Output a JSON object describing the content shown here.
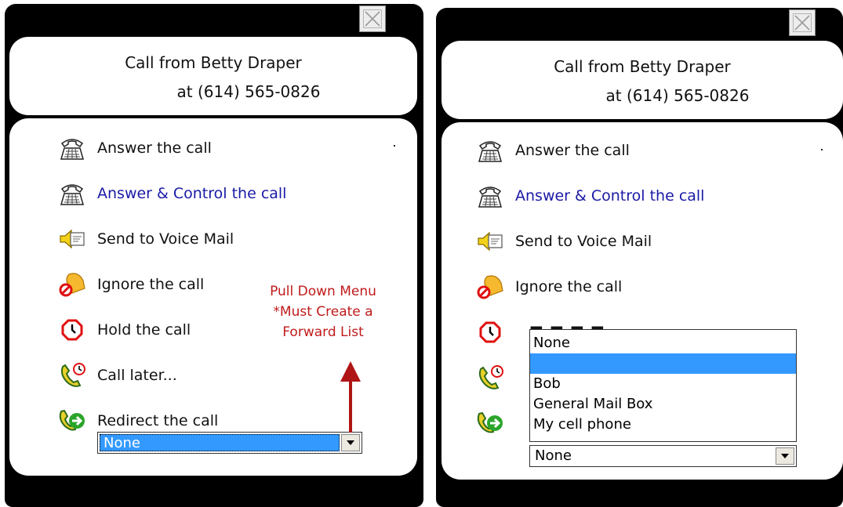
{
  "left": {
    "caller_line1": "Call from Betty Draper",
    "caller_line2": "at (614) 565-0826",
    "actions": [
      {
        "label": "Answer the call",
        "icon": "phone-icon",
        "link": false
      },
      {
        "label": "Answer & Control the call",
        "icon": "phone-icon",
        "link": true
      },
      {
        "label": "Send to Voice Mail",
        "icon": "voicemail-icon",
        "link": false
      },
      {
        "label": "Ignore the call",
        "icon": "bell-ignore-icon",
        "link": false
      },
      {
        "label": "Hold the call",
        "icon": "clock-hold-icon",
        "link": false
      },
      {
        "label": "Call later...",
        "icon": "phone-clock-icon",
        "link": false
      },
      {
        "label": "Redirect the call",
        "icon": "phone-redirect-icon",
        "link": false
      }
    ],
    "forward_select_value": "None",
    "annotation": [
      "Pull Down Menu",
      "*Must Create a",
      "Forward List"
    ]
  },
  "right": {
    "caller_line1": "Call from Betty Draper",
    "caller_line2": "at (614) 565-0826",
    "actions": [
      {
        "label": "Answer the call",
        "icon": "phone-icon",
        "link": false
      },
      {
        "label": "Answer & Control the call",
        "icon": "phone-icon",
        "link": true
      },
      {
        "label": "Send to Voice Mail",
        "icon": "voicemail-icon",
        "link": false
      },
      {
        "label": "Ignore the call",
        "icon": "bell-ignore-icon",
        "link": false
      }
    ],
    "dropdown_options": [
      "None",
      "",
      "Bob",
      "General Mail Box",
      "My cell phone"
    ],
    "forward_select_value": "None"
  },
  "colors": {
    "link": "#1a1aa6",
    "highlight": "#3399ff",
    "annotation": "#c01b1b"
  }
}
